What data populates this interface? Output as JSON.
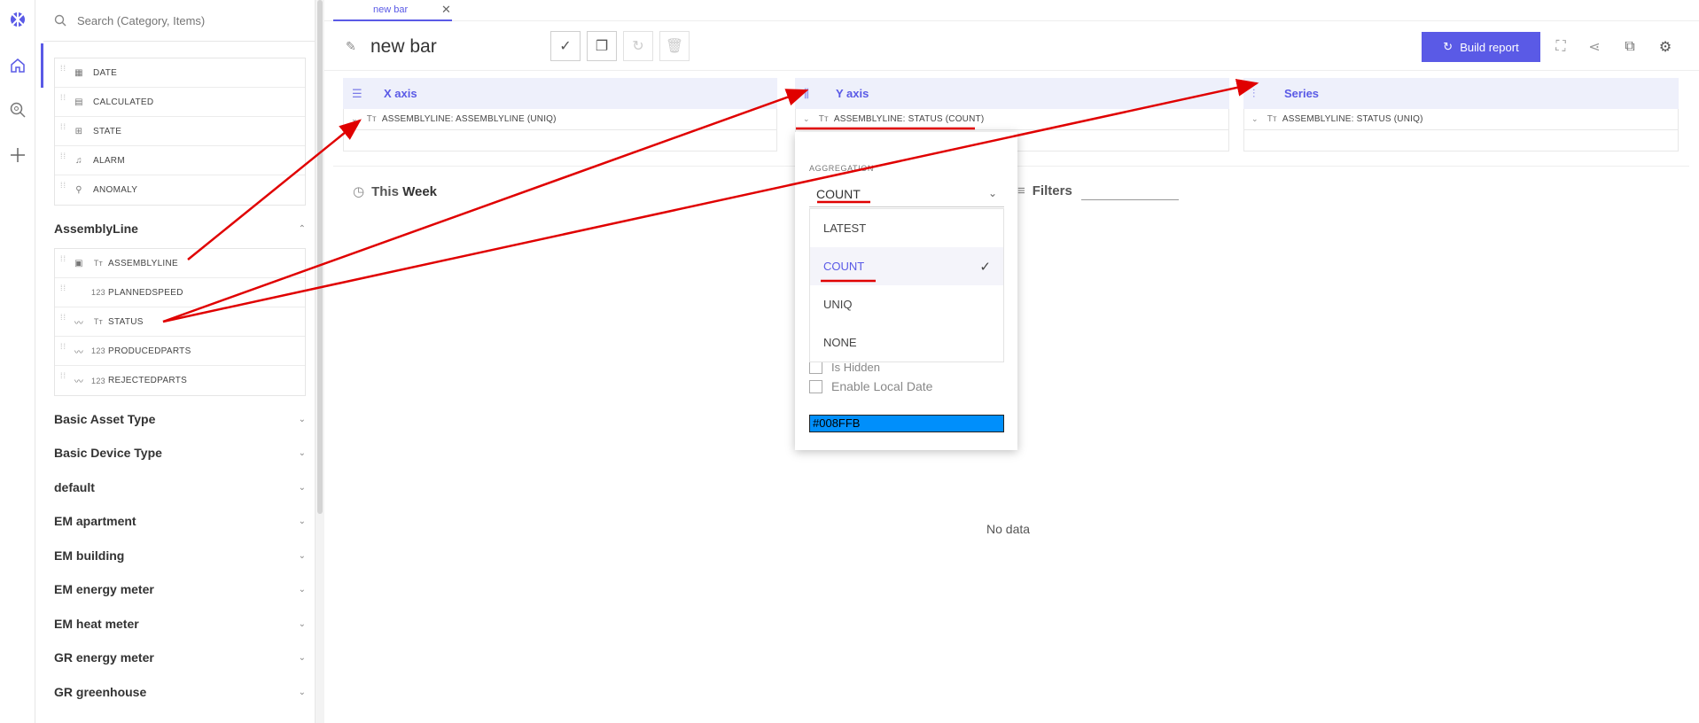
{
  "sidebar": {
    "search_placeholder": "Search (Category, Items)",
    "top_group": [
      {
        "icon": "calendar-icon",
        "label": "DATE"
      },
      {
        "icon": "calculator-icon",
        "label": "CALCULATED"
      },
      {
        "icon": "state-icon",
        "label": "STATE"
      },
      {
        "icon": "alarm-icon",
        "label": "ALARM"
      },
      {
        "icon": "magnify-icon",
        "label": "ANOMALY"
      }
    ],
    "assembly": {
      "title": "AssemblyLine",
      "items": [
        {
          "icon1": "▣",
          "type": "Tт",
          "label": "ASSEMBLYLINE"
        },
        {
          "icon1": "",
          "type": "123",
          "label": "PLANNEDSPEED"
        },
        {
          "icon1": "〰",
          "type": "Tт",
          "label": "STATUS"
        },
        {
          "icon1": "〰",
          "type": "123",
          "label": "PRODUCEDPARTS"
        },
        {
          "icon1": "〰",
          "type": "123",
          "label": "REJECTEDPARTS"
        }
      ]
    },
    "categories": [
      "Basic Asset Type",
      "Basic Device Type",
      "default",
      "EM apartment",
      "EM building",
      "EM energy meter",
      "EM heat meter",
      "GR energy meter",
      "GR greenhouse"
    ]
  },
  "tab": {
    "label": "new bar"
  },
  "title": {
    "name": "new bar"
  },
  "toolbar": {
    "build_label": "Build report"
  },
  "axes": {
    "x": {
      "title": "X axis",
      "field": "ASSEMBLYLINE: ASSEMBLYLINE (UNIQ)"
    },
    "y": {
      "title": "Y axis",
      "field": "ASSEMBLYLINE: STATUS (COUNT)"
    },
    "series": {
      "title": "Series",
      "field": "ASSEMBLYLINE: STATUS (UNIQ)"
    }
  },
  "period": {
    "this": "This",
    "range": "Week"
  },
  "filters": {
    "label": "Filters"
  },
  "main": {
    "no_data": "No data"
  },
  "popover": {
    "aggregation_label": "AGGREGATION",
    "selected": "COUNT",
    "options": [
      "LATEST",
      "COUNT",
      "UNIQ",
      "NONE"
    ],
    "hidden_label": "Is Hidden",
    "local_date_label": "Enable Local Date",
    "color_value": "#008FFB"
  },
  "colors": {
    "accent": "#5a5ae6",
    "annotation": "#e00000",
    "series_color": "#008ffb"
  }
}
